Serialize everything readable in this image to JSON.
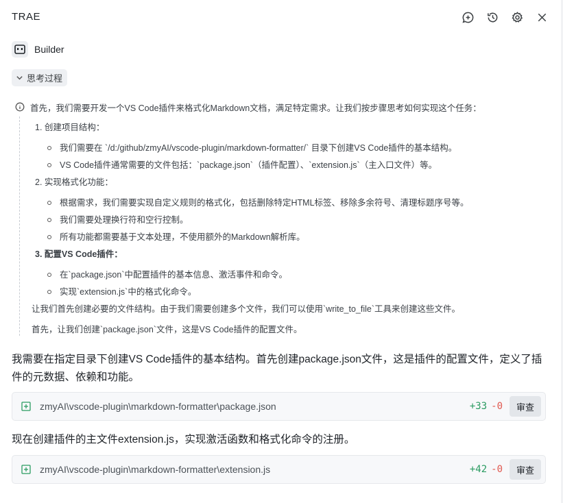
{
  "header": {
    "title": "TRAE"
  },
  "agent": {
    "name": "Builder"
  },
  "thinking": {
    "toggle_label": "思考过程",
    "intro": "首先，我们需要开发一个VS Code插件来格式化Markdown文档，满足特定需求。让我们按步骤思考如何实现这个任务：",
    "steps": [
      {
        "title": "1. 创建项目结构：",
        "items": [
          "我们需要在 `/d:/github/zmyAI/vscode-plugin/markdown-formatter/` 目录下创建VS Code插件的基本结构。",
          "VS Code插件通常需要的文件包括：`package.json`（插件配置）、`extension.js`（主入口文件）等。"
        ]
      },
      {
        "title": "2. 实现格式化功能：",
        "items": [
          "根据需求，我们需要实现自定义规则的格式化，包括删除特定HTML标签、移除多余符号、清理标题序号等。",
          "我们需要处理换行符和空行控制。",
          "所有功能都需要基于文本处理，不使用额外的Markdown解析库。"
        ]
      },
      {
        "title": "3. 配置VS Code插件：",
        "items": [
          "在`package.json`中配置插件的基本信息、激活事件和命令。",
          "实现`extension.js`中的格式化命令。"
        ]
      }
    ],
    "after_1": "让我们首先创建必要的文件结构。由于我们需要创建多个文件，我们可以使用`write_to_file`工具来创建这些文件。",
    "after_2": "首先，让我们创建`package.json`文件，这是VS Code插件的配置文件。"
  },
  "messages": [
    "我需要在指定目录下创建VS Code插件的基本结构。首先创建package.json文件，这是插件的配置文件，定义了插件的元数据、依赖和功能。",
    "现在创建插件的主文件extension.js，实现激活函数和格式化命令的注册。"
  ],
  "files": [
    {
      "path": "zmyAI\\vscode-plugin\\markdown-formatter\\package.json",
      "added": "+33",
      "removed": "-0",
      "review_label": "审查"
    },
    {
      "path": "zmyAI\\vscode-plugin\\markdown-formatter\\extension.js",
      "added": "+42",
      "removed": "-0",
      "review_label": "审查"
    }
  ],
  "colors": {
    "added": "#2a9b61",
    "removed": "#e0584f",
    "file_icon": "#2a9b61"
  }
}
